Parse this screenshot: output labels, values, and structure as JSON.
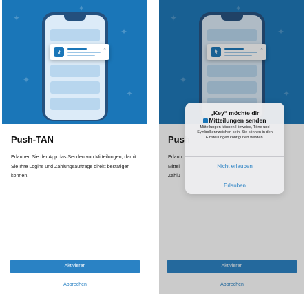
{
  "onboarding": {
    "title": "Push-TAN",
    "description": "Erlauben Sie der App das Senden von Mitteilungen, damit Sie Ihre Logins und Zahlungsaufträge direkt bestätigen können.",
    "primary_button": "Aktivieren",
    "secondary_button": "Abbrechen"
  },
  "dialog_screen": {
    "title_partial": "Push",
    "desc_partial_lines": [
      "Erlaub",
      "Mittei",
      "Zahlu"
    ],
    "primary_button": "Aktivieren",
    "secondary_button": "Abbrechen"
  },
  "permission_alert": {
    "title_line1": "„Key“ möchte dir",
    "title_line2": "Mitteilungen senden",
    "message": "Mitteilungen können Hinweise, Töne und Symbolkennzeichen sein. Sie können in den Einstellungen konfiguriert werden.",
    "deny_button": "Nicht erlauben",
    "allow_button": "Erlauben"
  },
  "icons": {
    "notification_app_icon": "key-icon",
    "sparkle": "sparkle-icon"
  },
  "colors": {
    "brand_blue": "#1a76b8",
    "button_blue": "#2a82c4",
    "phone_frame": "#24507e"
  }
}
